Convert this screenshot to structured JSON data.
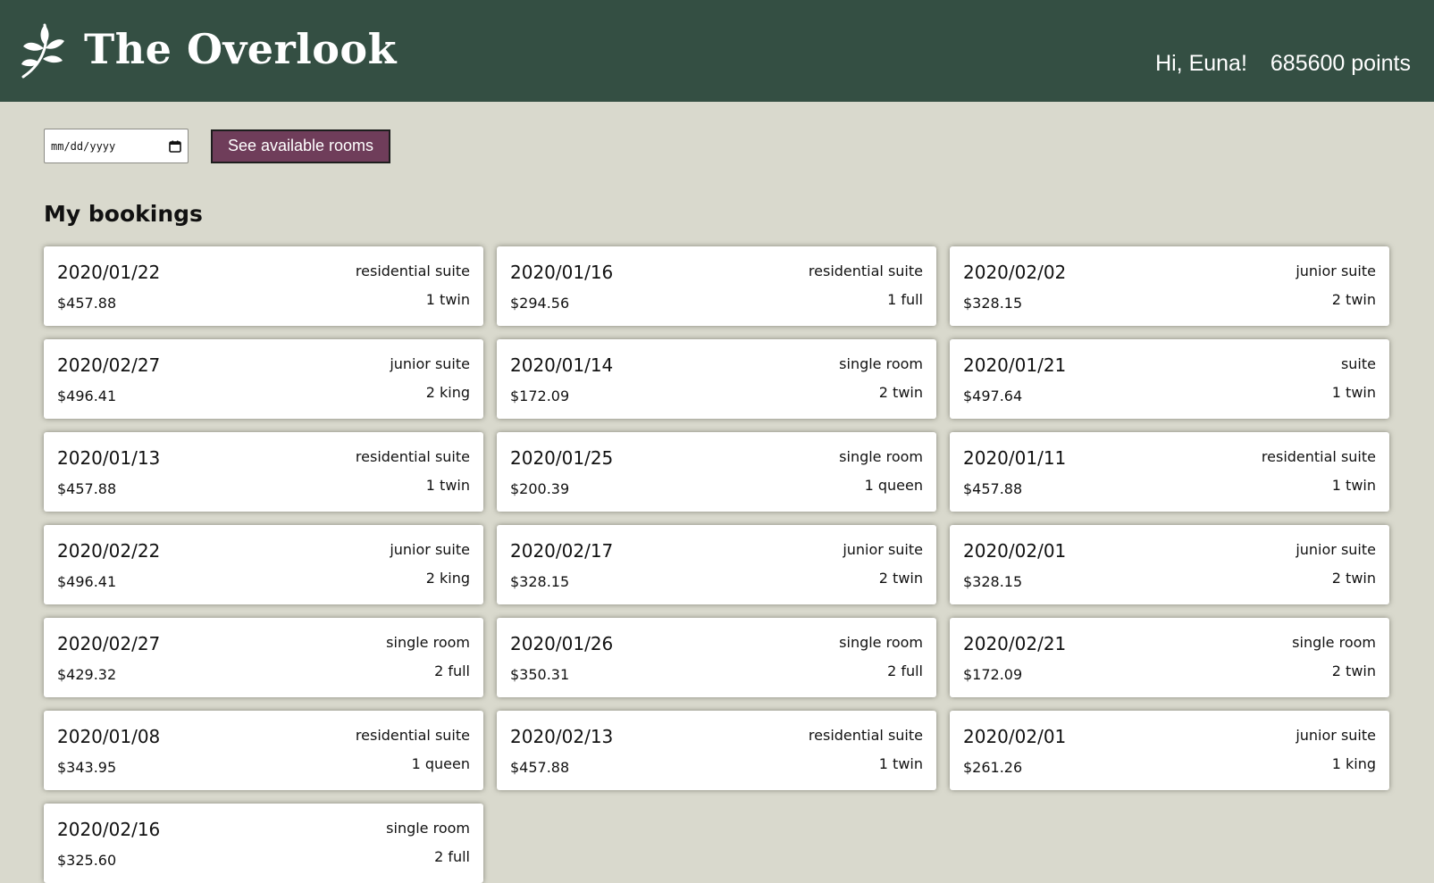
{
  "header": {
    "title": "The Overlook",
    "greeting": "Hi, Euna!",
    "points": "685600 points",
    "logo_icon": "leaf-sprig-icon"
  },
  "controls": {
    "date_placeholder": "mm/dd/yyyy",
    "calendar_icon": "calendar-icon",
    "button_label": "See available rooms"
  },
  "section": {
    "title": "My bookings"
  },
  "colors": {
    "header_bg": "#344f43",
    "page_bg": "#d9d9cd",
    "button_bg": "#6f3d5a"
  },
  "bookings": [
    {
      "date": "2020/01/22",
      "cost": "$457.88",
      "room_type": "residential suite",
      "beds": "1 twin"
    },
    {
      "date": "2020/01/16",
      "cost": "$294.56",
      "room_type": "residential suite",
      "beds": "1 full"
    },
    {
      "date": "2020/02/02",
      "cost": "$328.15",
      "room_type": "junior suite",
      "beds": "2 twin"
    },
    {
      "date": "2020/02/27",
      "cost": "$496.41",
      "room_type": "junior suite",
      "beds": "2 king"
    },
    {
      "date": "2020/01/14",
      "cost": "$172.09",
      "room_type": "single room",
      "beds": "2 twin"
    },
    {
      "date": "2020/01/21",
      "cost": "$497.64",
      "room_type": "suite",
      "beds": "1 twin"
    },
    {
      "date": "2020/01/13",
      "cost": "$457.88",
      "room_type": "residential suite",
      "beds": "1 twin"
    },
    {
      "date": "2020/01/25",
      "cost": "$200.39",
      "room_type": "single room",
      "beds": "1 queen"
    },
    {
      "date": "2020/01/11",
      "cost": "$457.88",
      "room_type": "residential suite",
      "beds": "1 twin"
    },
    {
      "date": "2020/02/22",
      "cost": "$496.41",
      "room_type": "junior suite",
      "beds": "2 king"
    },
    {
      "date": "2020/02/17",
      "cost": "$328.15",
      "room_type": "junior suite",
      "beds": "2 twin"
    },
    {
      "date": "2020/02/01",
      "cost": "$328.15",
      "room_type": "junior suite",
      "beds": "2 twin"
    },
    {
      "date": "2020/02/27",
      "cost": "$429.32",
      "room_type": "single room",
      "beds": "2 full"
    },
    {
      "date": "2020/01/26",
      "cost": "$350.31",
      "room_type": "single room",
      "beds": "2 full"
    },
    {
      "date": "2020/02/21",
      "cost": "$172.09",
      "room_type": "single room",
      "beds": "2 twin"
    },
    {
      "date": "2020/01/08",
      "cost": "$343.95",
      "room_type": "residential suite",
      "beds": "1 queen"
    },
    {
      "date": "2020/02/13",
      "cost": "$457.88",
      "room_type": "residential suite",
      "beds": "1 twin"
    },
    {
      "date": "2020/02/01",
      "cost": "$261.26",
      "room_type": "junior suite",
      "beds": "1 king"
    },
    {
      "date": "2020/02/16",
      "cost": "$325.60",
      "room_type": "single room",
      "beds": "2 full"
    }
  ]
}
